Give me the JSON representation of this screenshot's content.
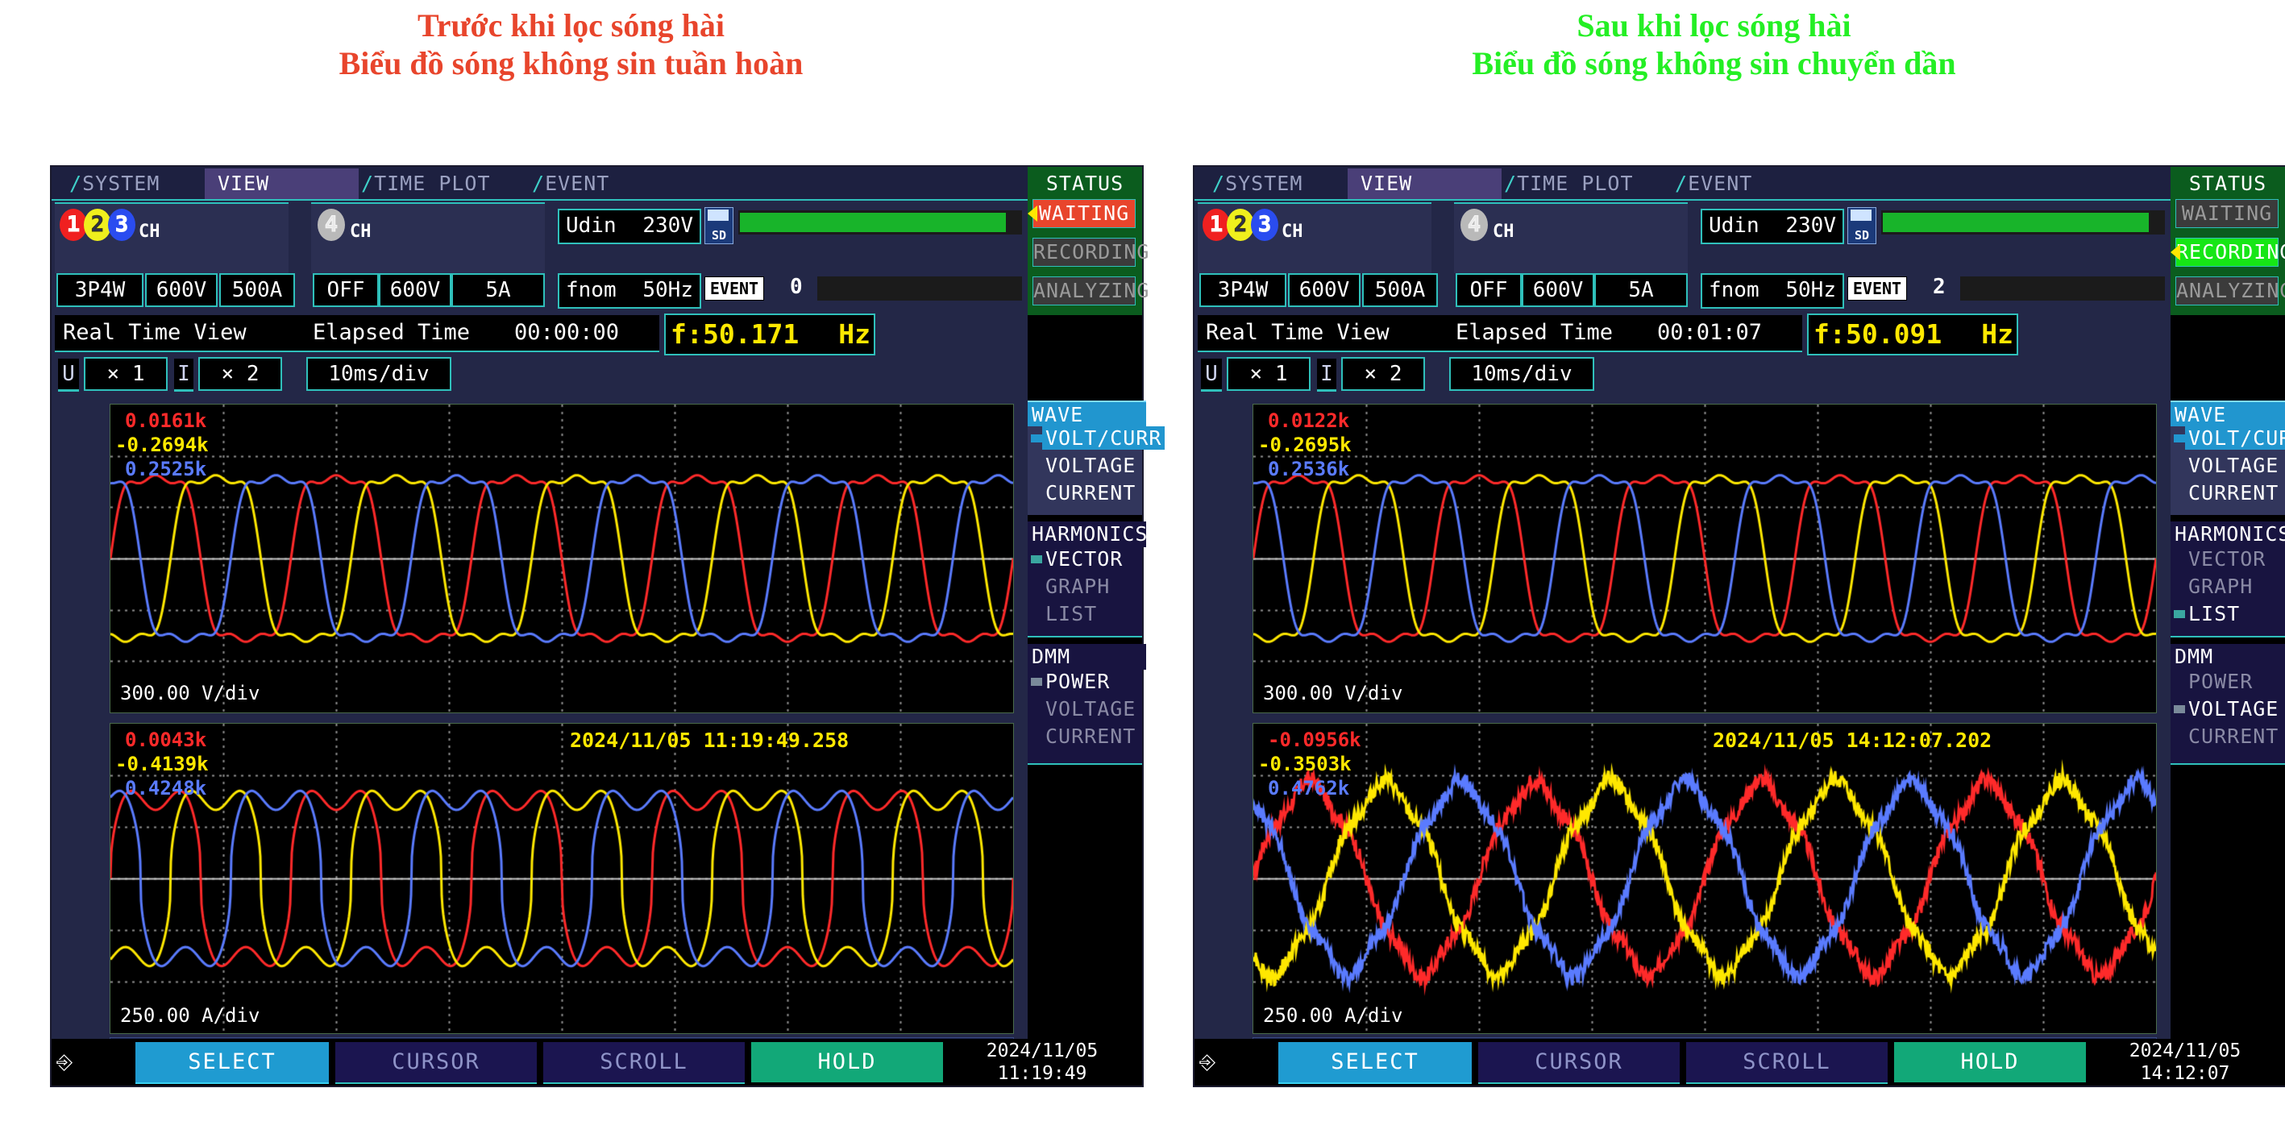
{
  "titles": {
    "left": [
      "Trước khi lọc sóng hài",
      "Biểu đồ sóng không sin tuần hoàn"
    ],
    "right": [
      "Sau khi lọc sóng hài",
      "Biểu đồ sóng không sin chuyển dần"
    ],
    "left_color": "#e8452c",
    "right_color": "#24ef24"
  },
  "tabs": [
    "SYSTEM",
    "VIEW",
    "TIME PLOT",
    "EVENT"
  ],
  "selected_tab": "VIEW",
  "channels": {
    "group1_label": "CH",
    "group1_chips": [
      "1",
      "2",
      "3"
    ],
    "group2_label": "CH",
    "group2_chip": "4",
    "group1_fields": [
      "3P4W",
      "600V",
      "500A"
    ],
    "group2_fields": [
      "OFF",
      "600V",
      "5A"
    ]
  },
  "settings": {
    "udin_label": "Udin",
    "udin_value": "230V",
    "fnom_label": "fnom",
    "fnom_value": "50Hz",
    "sd_label": "SD",
    "event_label": "EVENT"
  },
  "scale": {
    "u_label": "U",
    "u_value": "× 1",
    "i_label": "I",
    "i_value": "× 2",
    "timebase": "10ms/div"
  },
  "view": {
    "mode": "Real Time View",
    "elapsed_label": "Elapsed Time",
    "freq_prefix": "f:",
    "freq_unit": "Hz"
  },
  "sidebar": {
    "status_title": "STATUS",
    "status_items": [
      "WAITING",
      "RECORDING",
      "ANALYZING"
    ],
    "wave_head": "WAVE",
    "wave_items": [
      "VOLT/CURR",
      "VOLTAGE",
      "CURRENT"
    ],
    "harmonics_head": "HARMONICS",
    "harmonics_items": [
      "VECTOR",
      "GRAPH",
      "LIST"
    ],
    "dmm_head": "DMM",
    "dmm_items": [
      "POWER",
      "VOLTAGE",
      "CURRENT"
    ]
  },
  "softkeys": [
    "SELECT",
    "CURSOR",
    "SCROLL",
    "HOLD"
  ],
  "left_device": {
    "elapsed": "00:00:00",
    "frequency": "50.171",
    "event_count": "0",
    "status_active": "WAITING",
    "wave_selected": "VOLT/CURR",
    "harmonics_selected": "VECTOR",
    "dmm_selected": "POWER",
    "voltage_graph": {
      "red": "0.0161k",
      "yellow": "-0.2694k",
      "blue": "0.2525k",
      "div": "300.00 V/div"
    },
    "current_graph": {
      "red": "0.0043k",
      "yellow": "-0.4139k",
      "blue": "0.4248k",
      "div": "250.00 A/div",
      "timestamp": "2024/11/05 11:19:49.258"
    },
    "clock_date": "2024/11/05",
    "clock_time": "11:19:49"
  },
  "right_device": {
    "elapsed": "00:01:07",
    "frequency": "50.091",
    "event_count": "2",
    "status_active": "RECORDING",
    "wave_selected": "VOLT/CURR",
    "harmonics_selected": "LIST",
    "dmm_selected": "VOLTAGE",
    "voltage_graph": {
      "red": "0.0122k",
      "yellow": "-0.2695k",
      "blue": "0.2536k",
      "div": "300.00 V/div"
    },
    "current_graph": {
      "red": "-0.0956k",
      "yellow": "-0.3503k",
      "blue": "0.4762k",
      "div": "250.00 A/div",
      "timestamp": "2024/11/05 14:12:07.202"
    },
    "clock_date": "2024/11/05",
    "clock_time": "14:12:07"
  },
  "colors": {
    "phase_red": "#ff2a2a",
    "phase_yellow": "#ffe800",
    "phase_blue": "#5a7bff",
    "accent_teal": "#2fc0bb",
    "panel_bg": "#232747",
    "graph_bg": "#000000"
  }
}
